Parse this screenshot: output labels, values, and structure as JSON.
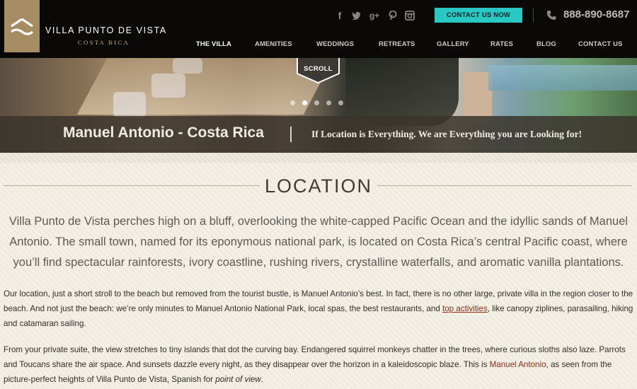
{
  "brand": {
    "name": "VILLA PUNTO DE VISTA",
    "sub": "COSTA RICA"
  },
  "header": {
    "social": [
      "f",
      "t",
      "g+",
      "p",
      "ig"
    ],
    "contact_button": "CONTACT US NOW",
    "phone": "888-890-8687"
  },
  "nav": {
    "items": [
      "THE VILLA",
      "AMENITIES",
      "WEDDINGS",
      "RETREATS",
      "GALLERY",
      "RATES",
      "BLOG",
      "CONTACT US"
    ],
    "active_index": 0
  },
  "hero": {
    "scroll_label": "SCROLL",
    "slide_count": 5,
    "active_slide": 1,
    "title": "Manuel Antonio - Costa Rica",
    "tagline": "If Location is Everything. We are Everything you are Looking for!"
  },
  "section": {
    "title": "LOCATION",
    "lead": "Villa Punto de Vista perches high on a bluff, overlooking the white-capped Pacific Ocean and the idyllic sands of Manuel Antonio. The small town, named for its eponymous national park, is located on Costa Rica’s central Pacific coast, where you’ll find spectacular rainforests, ivory coastline, rushing rivers, crystalline waterfalls, and aromatic vanilla plantations.",
    "p1_before": "Our location, just a short stroll to the beach but removed from the tourist bustle, is Manuel Antonio’s best. In fact, there is no other large, private villa in the region closer to the beach. And not just the beach: we’re only minutes to Manuel Antonio National Park, local spas, the  best restaurants, and ",
    "p1_link": "top activities",
    "p1_after": ", like canopy ziplines, parasailing, hiking and catamaran sailing.",
    "p2_before": "From your private suite, the view stretches to tiny islands that dot the curving bay. Endangered squirrel monkeys chatter in the trees, where curious sloths also laze. Parrots and Toucans share the air space. And sunsets dazzle every night, as they disappear over the horizon in a kaleidoscopic blaze. This is ",
    "p2_brand": "Manuel Antonio",
    "p2_middle": ", as seen from the picture-perfect heights of Villa Punto de Vista, Spanish for ",
    "p2_em": "point of view",
    "p2_after": "."
  },
  "colors": {
    "accent_teal": "#29c8c2",
    "gold": "#a68c62",
    "link": "#8b2c14",
    "header_bg": "#0b0907"
  }
}
